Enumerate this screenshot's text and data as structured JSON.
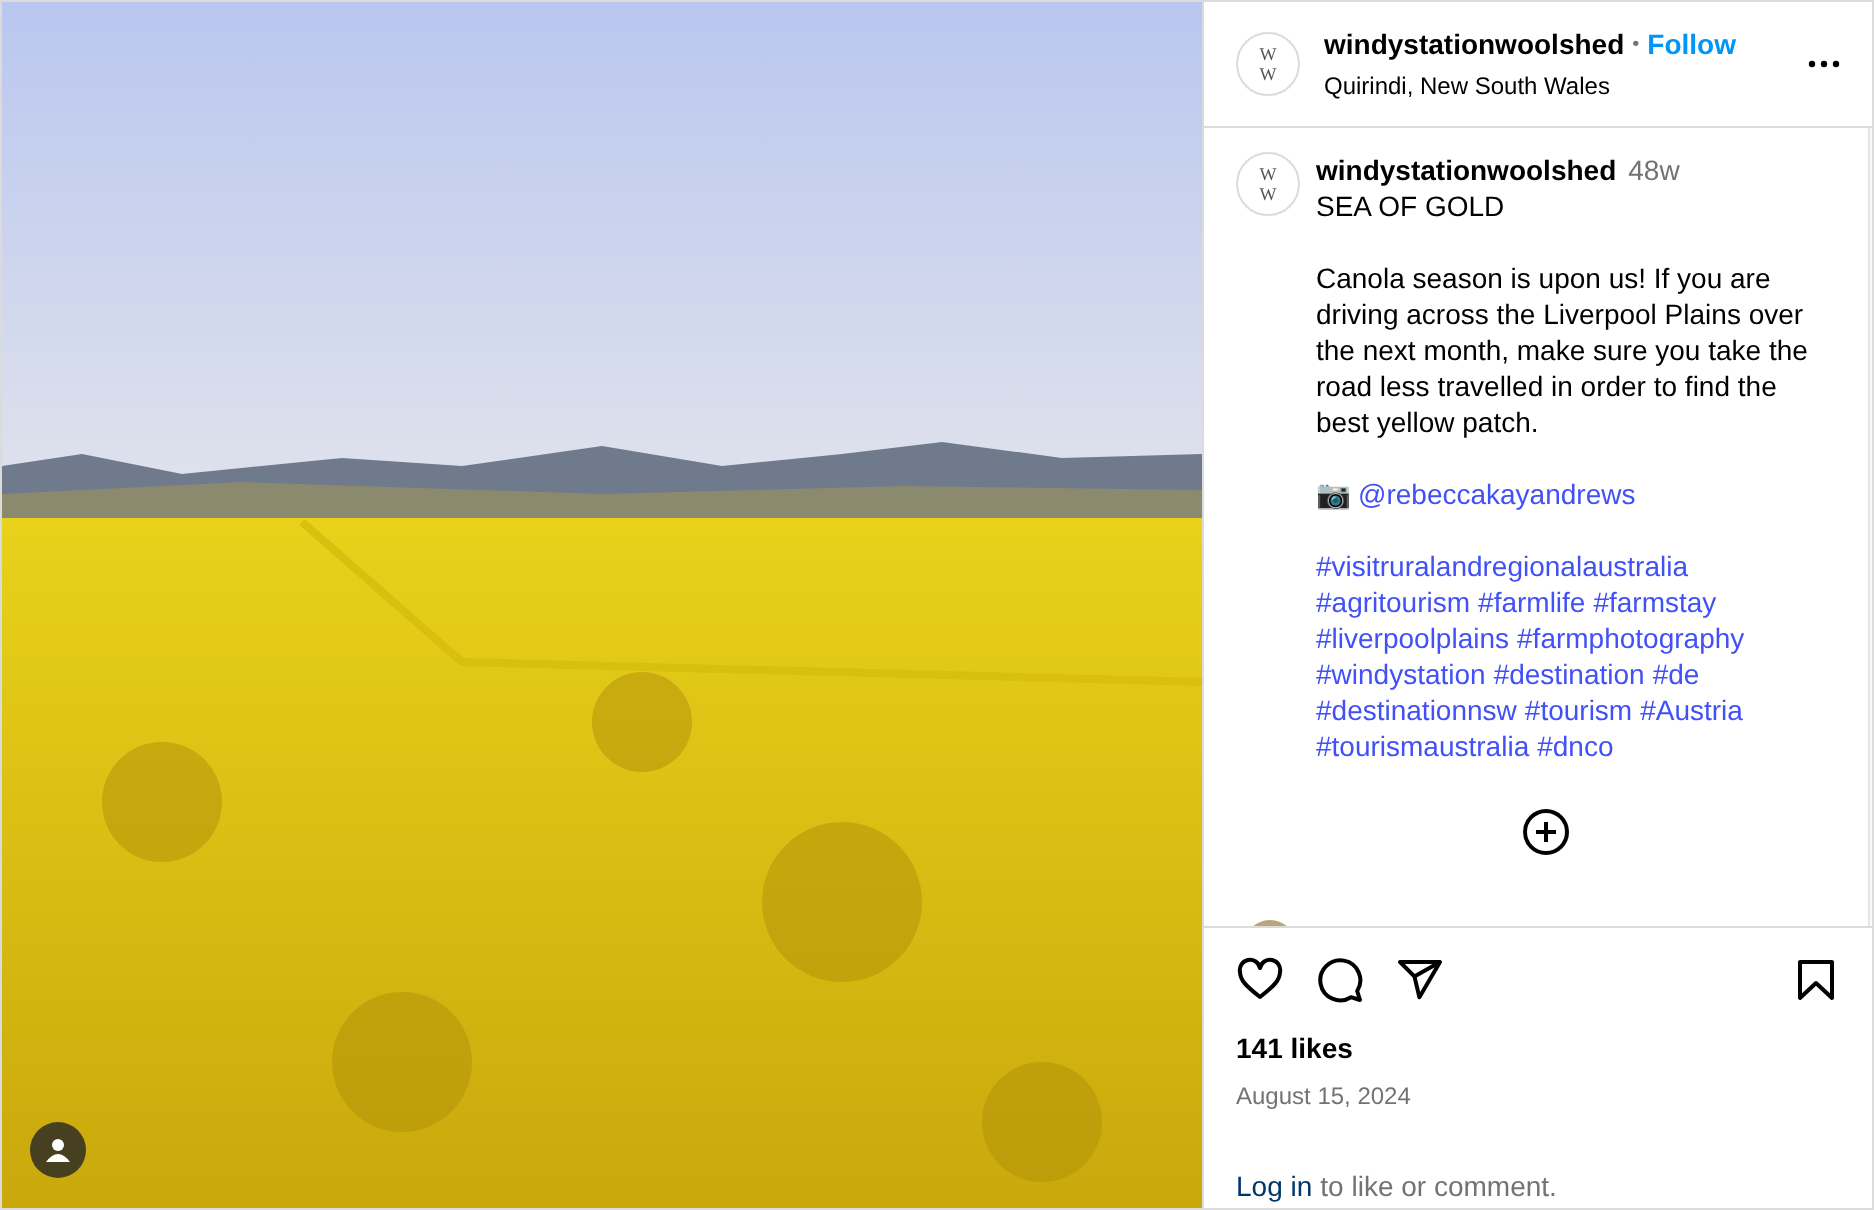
{
  "post_header": {
    "username": "windystationwoolshed",
    "separator": "•",
    "follow": "Follow",
    "location": "Quirindi, New South Wales",
    "avatar_text": [
      "W",
      "W"
    ]
  },
  "caption": {
    "username": "windystationwoolshed",
    "age": "48w",
    "avatar_text": [
      "W",
      "W"
    ],
    "title": "SEA OF GOLD",
    "body": "Canola season is upon us! If you are driving across the Liverpool Plains over the next month, make sure you take the road less travelled in order to find the best yellow patch.",
    "credit_icon": "📷",
    "credit": "@rebeccakayandrews",
    "hashtags": [
      "#visitruralandregionalaustralia",
      "#agritourism",
      "#farmlife",
      "#farmstay",
      "#liverpoolplains",
      "#farmphotography",
      "#windystation",
      "#destination",
      "#de",
      "#destinationnsw",
      "#tourism",
      "#Austria",
      "#tourismaustralia",
      "#dnco"
    ]
  },
  "likes": "141 likes",
  "date": "August 15, 2024",
  "login_prompt": {
    "link": "Log in",
    "text": "to like or comment."
  }
}
